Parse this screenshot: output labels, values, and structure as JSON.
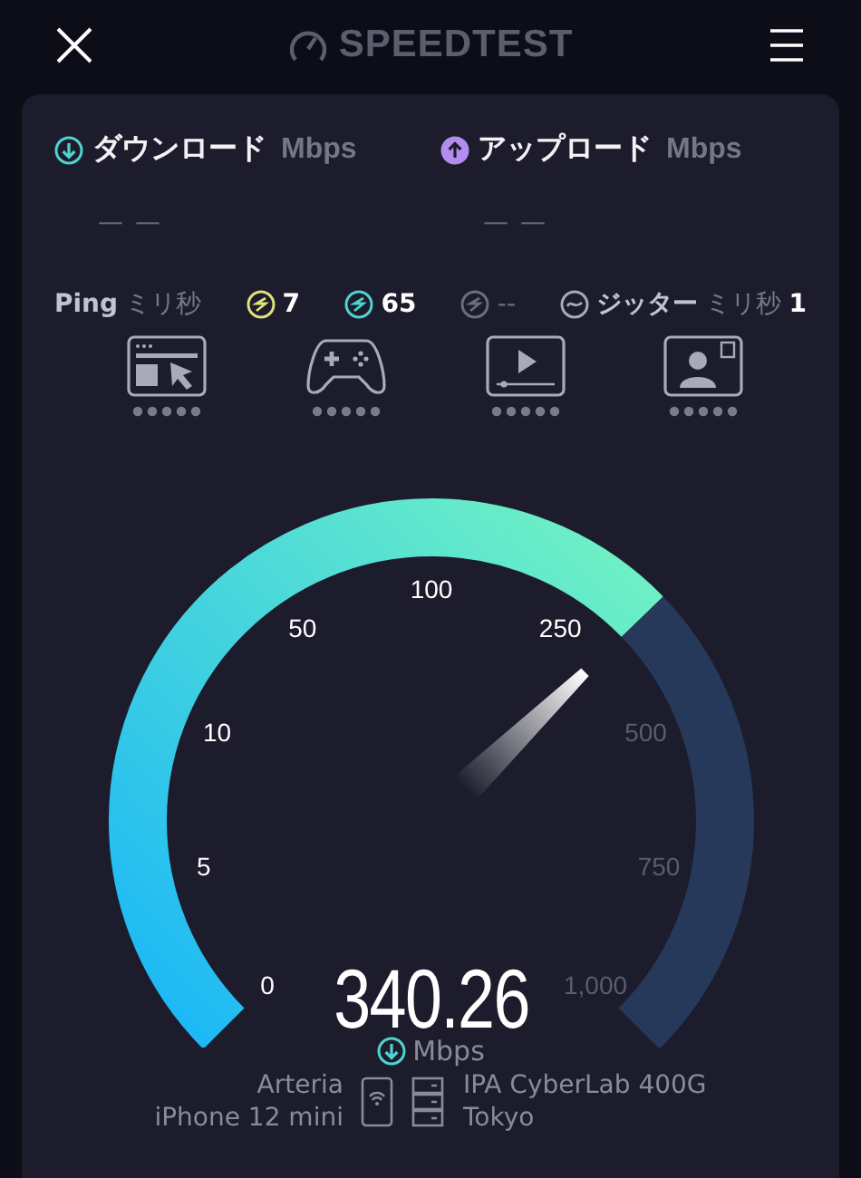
{
  "header": {
    "brand": "SPEEDTEST"
  },
  "results": [
    {
      "kind": "download",
      "label": "ダウンロード",
      "unit": "Mbps",
      "value": "— —"
    },
    {
      "kind": "upload",
      "label": "アップロード",
      "unit": "Mbps",
      "value": "— —"
    }
  ],
  "ping": {
    "label": "Ping",
    "unit": "ミリ秒",
    "items": [
      {
        "value": "7",
        "color": "#e3df7a"
      },
      {
        "value": "65",
        "color": "#4fd3d0"
      },
      {
        "value": "--",
        "color": "#6c6c82"
      }
    ]
  },
  "jitter": {
    "label": "ジッター",
    "unit": "ミリ秒",
    "value": "1"
  },
  "activities": [
    {
      "kind": "browsing"
    },
    {
      "kind": "gaming"
    },
    {
      "kind": "video"
    },
    {
      "kind": "call"
    }
  ],
  "gauge": {
    "ticks": [
      "0",
      "5",
      "10",
      "50",
      "100",
      "250",
      "500",
      "750",
      "1,000"
    ],
    "reading": "340.26",
    "unit": "Mbps"
  },
  "connection": {
    "provider": "Arteria",
    "device": "iPhone 12 mini",
    "server": "IPA CyberLab 400G",
    "location": "Tokyo"
  }
}
